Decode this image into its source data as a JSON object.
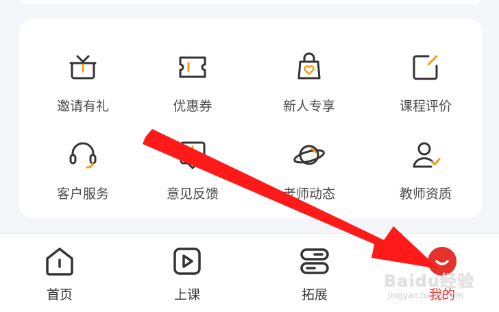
{
  "grid": {
    "items": [
      {
        "label": "邀请有礼",
        "icon": "gift-icon"
      },
      {
        "label": "优惠券",
        "icon": "ticket-icon"
      },
      {
        "label": "新人专享",
        "icon": "shopping-bag-heart-icon"
      },
      {
        "label": "课程评价",
        "icon": "edit-icon"
      },
      {
        "label": "客户服务",
        "icon": "headset-icon"
      },
      {
        "label": "意见反馈",
        "icon": "feedback-icon"
      },
      {
        "label": "老师动态",
        "icon": "planet-icon"
      },
      {
        "label": "教师资质",
        "icon": "user-check-icon"
      }
    ]
  },
  "tabbar": {
    "tabs": [
      {
        "label": "首页",
        "icon": "home-icon"
      },
      {
        "label": "上课",
        "icon": "play-icon"
      },
      {
        "label": "拓展",
        "icon": "expand-icon"
      },
      {
        "label": "我的",
        "icon": "profile-face-icon"
      }
    ],
    "active_index": 3
  },
  "watermark": {
    "brand": "Baidu经验",
    "url": "jingyan.baidu.com"
  },
  "colors": {
    "accent": "#f39c12",
    "active": "#e6312d",
    "arrow": "#ff1a1a",
    "icon": "#333333"
  }
}
